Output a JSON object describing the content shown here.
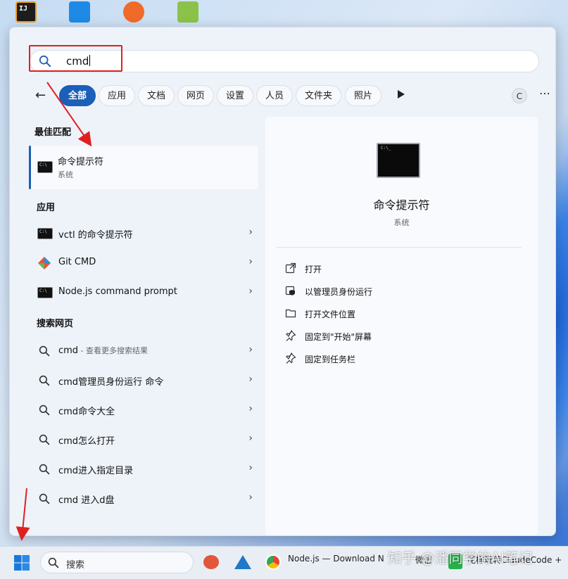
{
  "search": {
    "value": "cmd"
  },
  "filters": [
    "全部",
    "应用",
    "文档",
    "网页",
    "设置",
    "人员",
    "文件夹",
    "照片"
  ],
  "filter_c": "C",
  "best_match": {
    "heading": "最佳匹配",
    "title": "命令提示符",
    "subtitle": "系统"
  },
  "apps": {
    "heading": "应用",
    "items": [
      "vctl 的命令提示符",
      "Git CMD",
      "Node.js command prompt"
    ]
  },
  "web": {
    "heading": "搜索网页",
    "first_query": "cmd",
    "first_hint": " - 查看更多搜索结果",
    "items": [
      "cmd管理员身份运行 命令",
      "cmd命令大全",
      "cmd怎么打开",
      "cmd进入指定目录",
      "cmd 进入d盘"
    ]
  },
  "detail": {
    "title": "命令提示符",
    "kind": "系统",
    "actions": [
      "打开",
      "以管理员身份运行",
      "打开文件位置",
      "固定到\"开始\"屏幕",
      "固定到任务栏"
    ]
  },
  "taskbar": {
    "search_label": "搜索",
    "apps": [
      "Node.js — Download N",
      "微信",
      "花样玩转ClaudeCode +"
    ]
  },
  "watermark": "知乎 @潘同学的AI笔记",
  "colors": {
    "accent": "#1b5fb8",
    "annotation": "#e02020"
  }
}
